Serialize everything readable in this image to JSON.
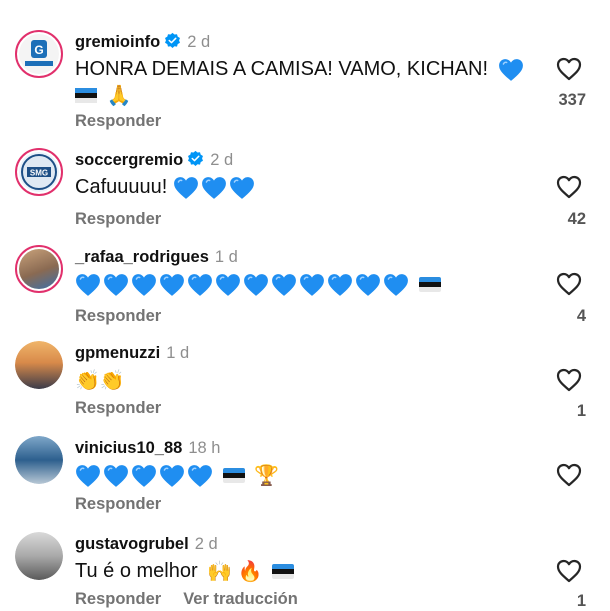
{
  "comments": [
    {
      "user": "gremioinfo",
      "verified": true,
      "time": "2 d",
      "text": "HONRA DEMAIS A CAMISA! VAMO, KICHAN!",
      "likes": "337",
      "reply": "Responder"
    },
    {
      "user": "soccergremio",
      "verified": true,
      "time": "2 d",
      "text": "Cafuuuuu!",
      "likes": "42",
      "reply": "Responder"
    },
    {
      "user": "_rafaa_rodrigues",
      "verified": false,
      "time": "1 d",
      "text": "",
      "likes": "4",
      "reply": "Responder"
    },
    {
      "user": "gpmenuzzi",
      "verified": false,
      "time": "1 d",
      "text": "",
      "likes": "1",
      "reply": "Responder"
    },
    {
      "user": "vinicius10_88",
      "verified": false,
      "time": "18 h",
      "text": "",
      "likes": "",
      "reply": "Responder"
    },
    {
      "user": "gustavogrubel",
      "verified": false,
      "time": "2 d",
      "text": "Tu é o melhor",
      "likes": "1",
      "reply": "Responder",
      "translate": "Ver traducción"
    }
  ],
  "colors": {
    "heart_blue": "#1f8ef1",
    "verified_blue": "#0095f6",
    "ring": "#e1306c"
  }
}
